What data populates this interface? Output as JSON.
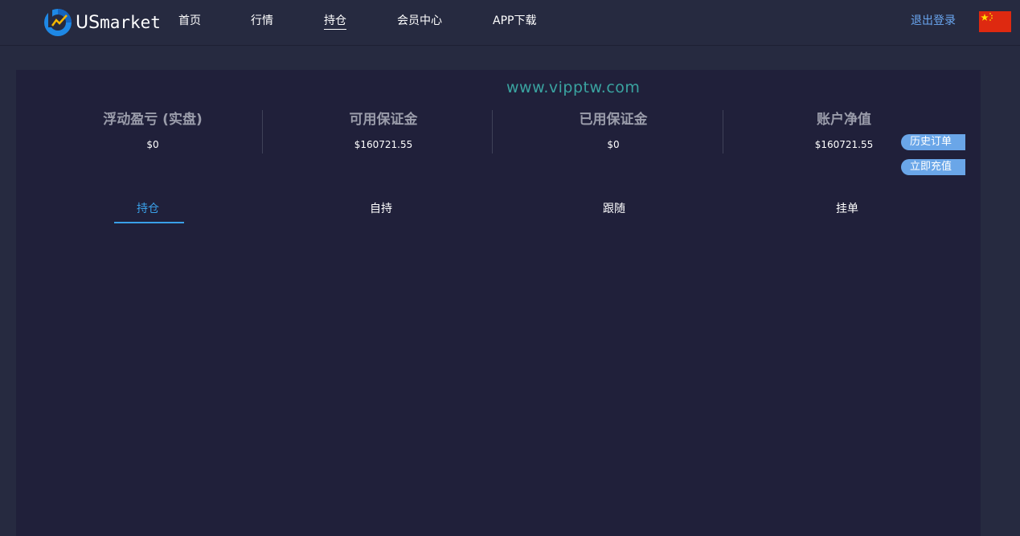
{
  "header": {
    "logo_text_us": "US",
    "logo_text_market": "market",
    "nav": [
      {
        "label": "首页"
      },
      {
        "label": "行情"
      },
      {
        "label": "持仓"
      },
      {
        "label": "会员中心"
      },
      {
        "label": "APP下载"
      }
    ],
    "active_nav": "持仓",
    "logout_label": "退出登录",
    "flag_icon": "china-flag-icon"
  },
  "watermark": "www.vipptw.com",
  "stats": [
    {
      "title": "浮动盈亏 (实盘)",
      "value": "$0"
    },
    {
      "title": "可用保证金",
      "value": "$160721.55"
    },
    {
      "title": "已用保证金",
      "value": "$0"
    },
    {
      "title": "账户净值",
      "value": "$160721.55"
    }
  ],
  "side_buttons": {
    "history_orders": "历史订单",
    "recharge": "立即充值"
  },
  "tabs": [
    {
      "label": "持仓"
    },
    {
      "label": "自持"
    },
    {
      "label": "跟随"
    },
    {
      "label": "挂单"
    }
  ],
  "active_tab": "持仓",
  "colors": {
    "background": "#262a40",
    "panel": "#20203a",
    "accent": "#3aa0e8",
    "logout": "#6aa6f0",
    "button": "#6aa6e8",
    "watermark": "#3aa3a0"
  }
}
